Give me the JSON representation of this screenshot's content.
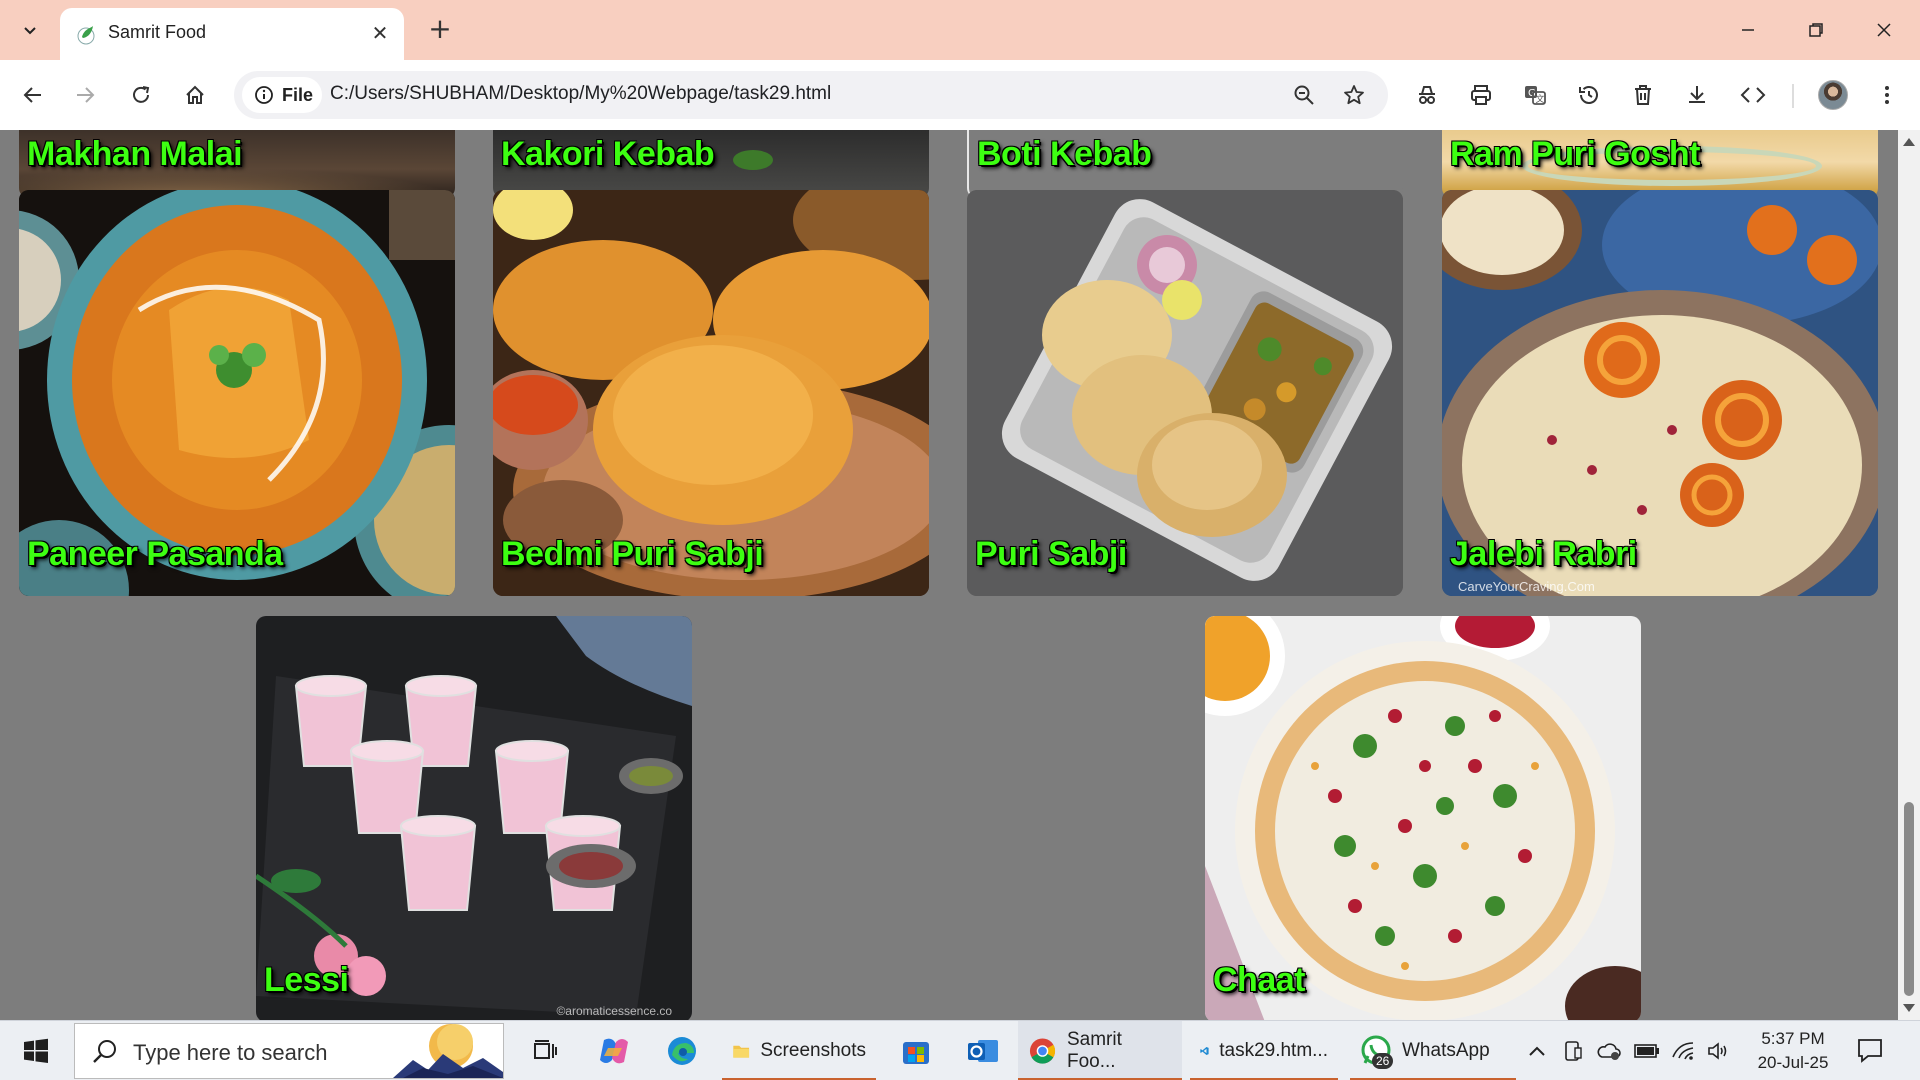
{
  "browser": {
    "tab_title": "Samrit Food",
    "site_chip": "File",
    "url": "C:/Users/SHUBHAM/Desktop/My%20Webpage/task29.html"
  },
  "page": {
    "top_row": [
      {
        "label": "Makhan Malai"
      },
      {
        "label": "Kakori Kebab"
      },
      {
        "label": "Boti Kebab"
      },
      {
        "label": "Ram Puri Gosht"
      }
    ],
    "row2": [
      {
        "label": "Paneer Pasanda"
      },
      {
        "label": "Bedmi Puri Sabji"
      },
      {
        "label": "Puri Sabji"
      },
      {
        "label": "Jalebi Rabri",
        "watermark": "CarveYourCraving.Com"
      }
    ],
    "row3": [
      {
        "label": "Lessi",
        "watermark": "©aromaticessence.co"
      },
      {
        "label": "Chaat"
      }
    ],
    "label_color": "#3dff12",
    "background": "#7d7d7d"
  },
  "taskbar": {
    "search_placeholder": "Type here to search",
    "apps": [
      {
        "label": "Screenshots",
        "icon": "folder-icon"
      },
      {
        "label": "Samrit Foo...",
        "icon": "chrome-icon"
      },
      {
        "label": "task29.htm...",
        "icon": "vscode-icon"
      },
      {
        "label": "WhatsApp",
        "icon": "whatsapp-icon",
        "badge": "26"
      }
    ],
    "time": "5:37 PM",
    "date": "20-Jul-25"
  }
}
